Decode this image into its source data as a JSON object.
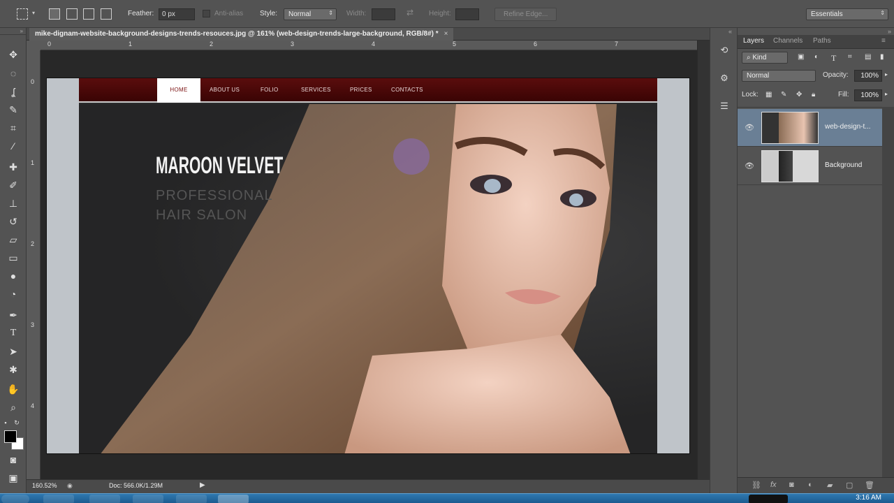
{
  "options_bar": {
    "feather_label": "Feather:",
    "feather_value": "0 px",
    "antialias_label": "Anti-alias",
    "style_label": "Style:",
    "style_value": "Normal",
    "width_label": "Width:",
    "height_label": "Height:",
    "refine_edge_label": "Refine Edge...",
    "workspace_value": "Essentials"
  },
  "document": {
    "tab_title": "mike-dignam-website-background-designs-trends-resouces.jpg @ 161% (web-design-trends-large-background, RGB/8#) *",
    "ruler_top_marks": [
      "0",
      "1",
      "2",
      "3",
      "4",
      "5",
      "6",
      "7"
    ],
    "ruler_left_marks": [
      "0",
      "1",
      "2",
      "3",
      "4"
    ]
  },
  "canvas": {
    "nav_items": [
      "HOME",
      "ABOUT US",
      "FOLIO",
      "SERVICES",
      "PRICES",
      "CONTACTS"
    ],
    "title": "MAROON VELVET",
    "subtitle_line1": "PROFESSIONAL",
    "subtitle_line2": "HAIR SALON"
  },
  "status_bar": {
    "zoom": "160.52%",
    "doc_info": "Doc: 566.0K/1.29M"
  },
  "layers_panel": {
    "tabs": [
      "Layers",
      "Channels",
      "Paths"
    ],
    "kind_filter": "Kind",
    "blend_mode": "Normal",
    "opacity_label": "Opacity:",
    "opacity_value": "100%",
    "lock_label": "Lock:",
    "fill_label": "Fill:",
    "fill_value": "100%",
    "layers": [
      {
        "name": "web-design-t...",
        "selected": true
      },
      {
        "name": "Background",
        "selected": false
      }
    ]
  },
  "taskbar": {
    "clock": "3:16 AM"
  },
  "colors": {
    "panel": "#535353",
    "accent_selected": "#6a7f95",
    "nav_maroon": "#4a0808"
  }
}
